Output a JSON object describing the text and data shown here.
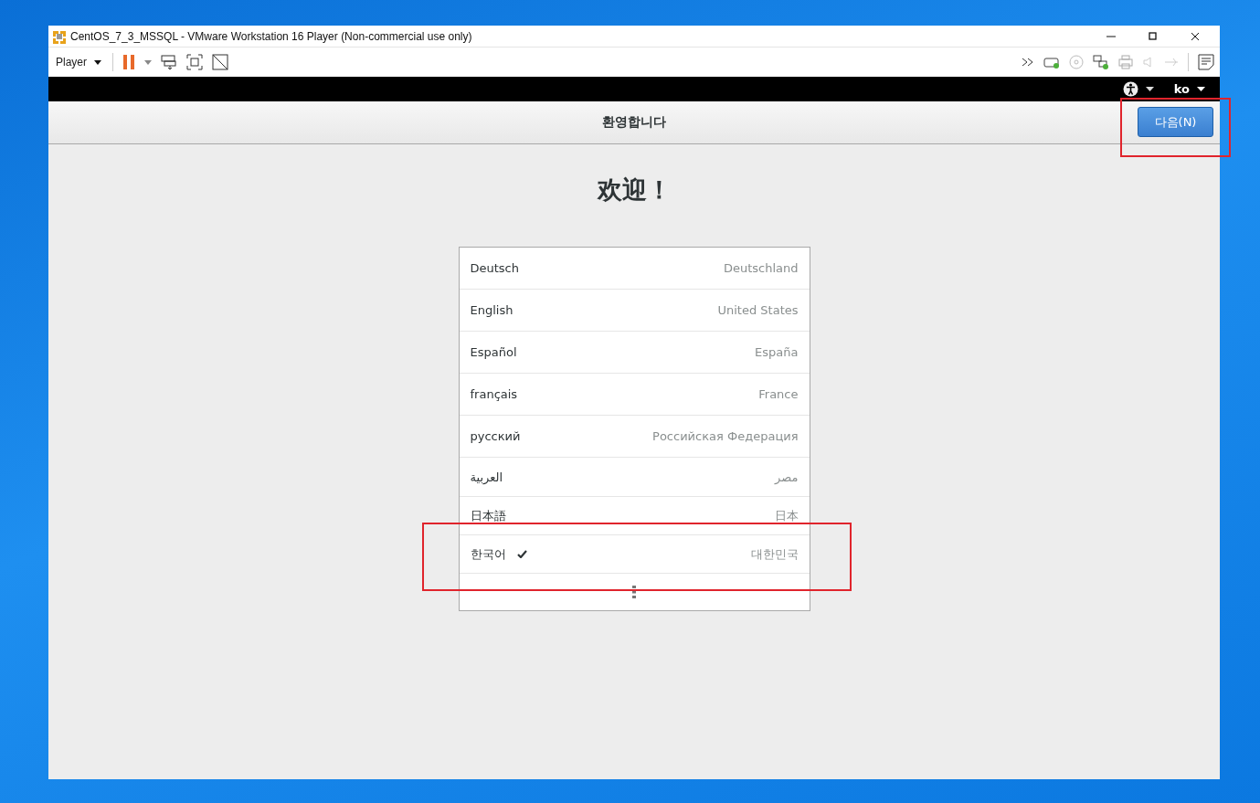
{
  "window": {
    "title": "CentOS_7_3_MSSQL - VMware Workstation 16 Player (Non-commercial use only)"
  },
  "toolbar": {
    "player_menu": "Player"
  },
  "guest_topbar": {
    "language": "ko"
  },
  "header": {
    "title": "환영합니다",
    "next_button": "다음(N)"
  },
  "welcome": "欢迎！",
  "languages": [
    {
      "name": "Deutsch",
      "region": "Deutschland",
      "selected": false
    },
    {
      "name": "English",
      "region": "United States",
      "selected": false
    },
    {
      "name": "Español",
      "region": "España",
      "selected": false
    },
    {
      "name": "français",
      "region": "France",
      "selected": false
    },
    {
      "name": "русский",
      "region": "Российская Федерация",
      "selected": false
    },
    {
      "name": "العربية",
      "region": "مصر",
      "selected": false
    },
    {
      "name": "日本語",
      "region": "日本",
      "selected": false
    },
    {
      "name": "한국어",
      "region": "대한민국",
      "selected": true
    }
  ]
}
